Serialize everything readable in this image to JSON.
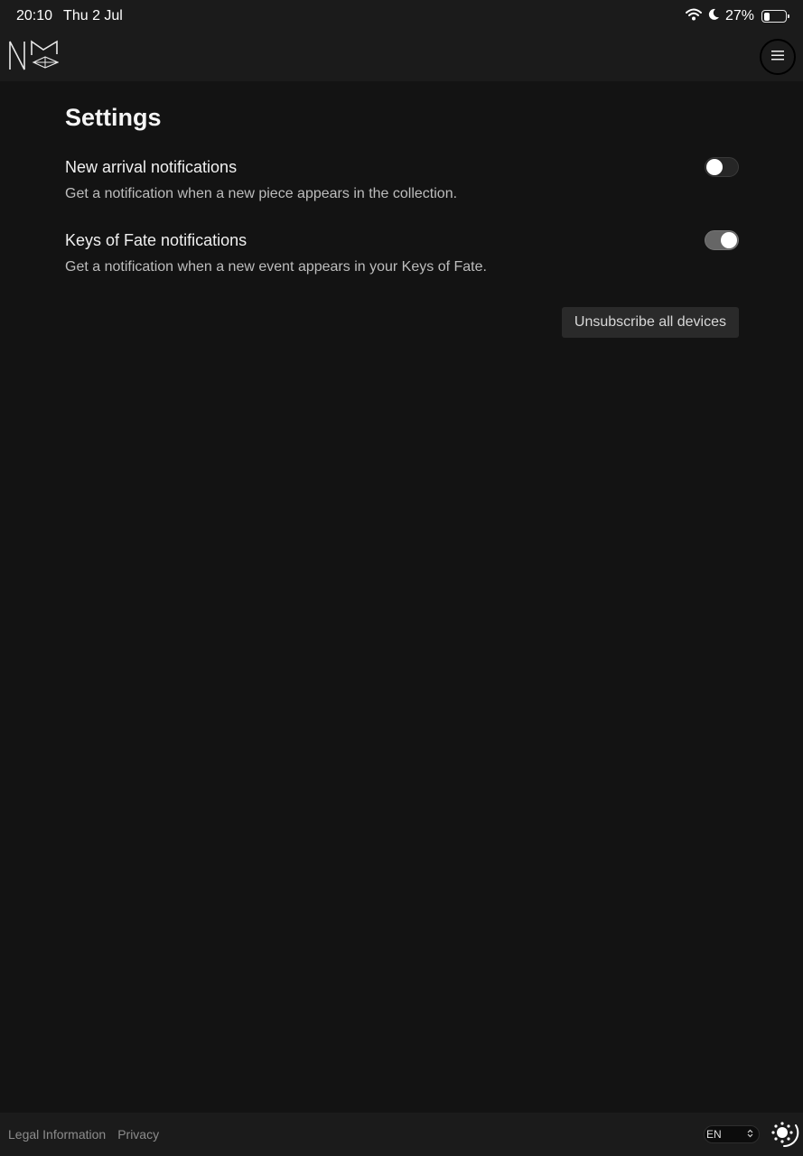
{
  "status_bar": {
    "time": "20:10",
    "date": "Thu 2 Jul",
    "battery": "27%",
    "battery_level": 0.27,
    "icons": [
      "wifi-icon",
      "moon-icon",
      "battery-icon"
    ]
  },
  "header": {
    "logo": "NM",
    "menu_icon": "hamburger-icon"
  },
  "main": {
    "title": "Settings",
    "settings": [
      {
        "label": "New arrival notifications",
        "description": "Get a notification when a new piece appears in the collection.",
        "enabled": false
      },
      {
        "label": "Keys of Fate notifications",
        "description": "Get a notification when a new event appears in your Keys of Fate.",
        "enabled": true
      }
    ],
    "unsubscribe_label": "Unsubscribe all devices"
  },
  "footer": {
    "links": [
      "Legal Information",
      "Privacy"
    ],
    "language": "EN",
    "theme_icon": "sun-icon"
  },
  "colors": {
    "background": "#131313",
    "bar": "#1b1b1b",
    "text": "#f0f0f0",
    "muted": "#bdbdbd",
    "toggle_on": "#666666"
  }
}
